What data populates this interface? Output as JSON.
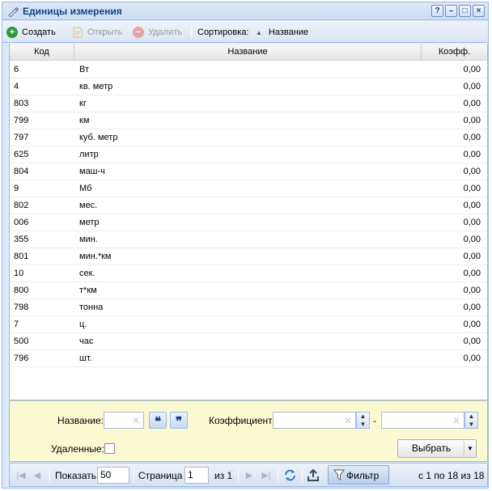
{
  "window": {
    "title": "Единицы измерения",
    "controls": [
      "?",
      "–",
      "□",
      "×"
    ]
  },
  "toolbar": {
    "create_label": "Создать",
    "open_label": "Открыть",
    "delete_label": "Удалить",
    "sort_label": "Сортировка:",
    "sort_field_label": "Название"
  },
  "grid": {
    "columns": [
      "Код",
      "Название",
      "Коэфф."
    ],
    "rows": [
      {
        "code": "6",
        "name": "Вт",
        "coef": "0,00"
      },
      {
        "code": "4",
        "name": "кв. метр",
        "coef": "0,00"
      },
      {
        "code": "803",
        "name": "кг",
        "coef": "0,00"
      },
      {
        "code": "799",
        "name": "км",
        "coef": "0,00"
      },
      {
        "code": "797",
        "name": "куб. метр",
        "coef": "0,00"
      },
      {
        "code": "625",
        "name": "литр",
        "coef": "0,00"
      },
      {
        "code": "804",
        "name": "маш-ч",
        "coef": "0,00"
      },
      {
        "code": "9",
        "name": "Мб",
        "coef": "0,00"
      },
      {
        "code": "802",
        "name": "мес.",
        "coef": "0,00"
      },
      {
        "code": "006",
        "name": "метр",
        "coef": "0,00"
      },
      {
        "code": "355",
        "name": "мин.",
        "coef": "0,00"
      },
      {
        "code": "801",
        "name": "мин.*км",
        "coef": "0,00"
      },
      {
        "code": "10",
        "name": "сек.",
        "coef": "0,00"
      },
      {
        "code": "800",
        "name": "т*км",
        "coef": "0,00"
      },
      {
        "code": "798",
        "name": "тонна",
        "coef": "0,00"
      },
      {
        "code": "7",
        "name": "ц.",
        "coef": "0,00"
      },
      {
        "code": "500",
        "name": "час",
        "coef": "0,00"
      },
      {
        "code": "796",
        "name": "шт.",
        "coef": "0,00"
      }
    ]
  },
  "filter": {
    "name_label": "Название:",
    "name_value": "",
    "quote_open": "❝",
    "quote_close": "❞",
    "coef_label": "Коэффициент:",
    "coef_from": "",
    "coef_dash": "-",
    "coef_to": "",
    "deleted_label": "Удаленные:",
    "deleted_checked": false,
    "select_label": "Выбрать"
  },
  "pager": {
    "show_label": "Показать",
    "page_size": "50",
    "page_label": "Страница",
    "page_value": "1",
    "of_label": "из 1",
    "filter_label": "Фильтр",
    "summary": "с 1 по 18 из 18"
  },
  "colors": {
    "accent": "#15428b",
    "border": "#99bbe8",
    "create_green": "#2e9a3a",
    "filter_bg": "#fbf9d1"
  }
}
